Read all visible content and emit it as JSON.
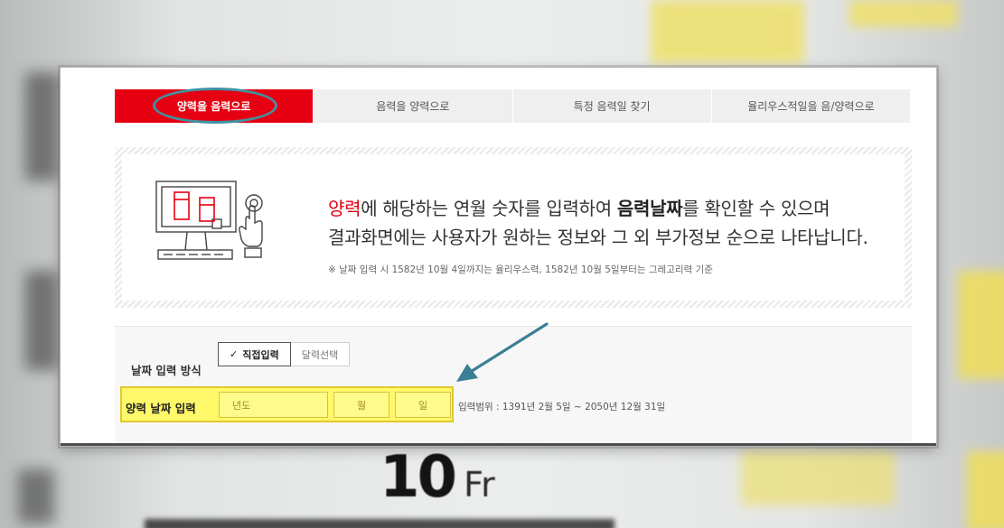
{
  "tabs": [
    {
      "label": "양력을 음력으로",
      "active": true
    },
    {
      "label": "음력을 양력으로",
      "active": false
    },
    {
      "label": "특정 음력일 찾기",
      "active": false
    },
    {
      "label": "율리우스적일을 음/양력으로",
      "active": false
    }
  ],
  "info": {
    "line1": {
      "red": "양력",
      "mid1": "에 해당하는 연월 숫자를 입력하여 ",
      "bold": "음력날짜",
      "mid2": "를 확인할 수 있으며"
    },
    "line2": "결과화면에는 사용자가 원하는 정보와 그 외 부가정보 순으로 나타납니다.",
    "note": "※ 날짜 입력 시 1582년 10월 4일까지는 율리우스력, 1582년 10월 5일부터는 그레고리력 기준"
  },
  "form": {
    "method_label": "날짜 입력 방식",
    "method_options": [
      "직접입력",
      "달력선택"
    ],
    "selected_method": "직접입력",
    "date_label": "양력 날짜 입력",
    "year_placeholder": "년도",
    "month_placeholder": "월",
    "day_placeholder": "일",
    "range_text": "입력범위 : 1391년 2월 5일 ~ 2050년 12월 31일"
  },
  "background": {
    "date_number": "10",
    "date_day": "Fr"
  },
  "colors": {
    "accent_red": "#e60012",
    "highlight_circle": "#3f92a4",
    "yellow_zone": "#fff96a",
    "arrow": "#3a7f95"
  }
}
